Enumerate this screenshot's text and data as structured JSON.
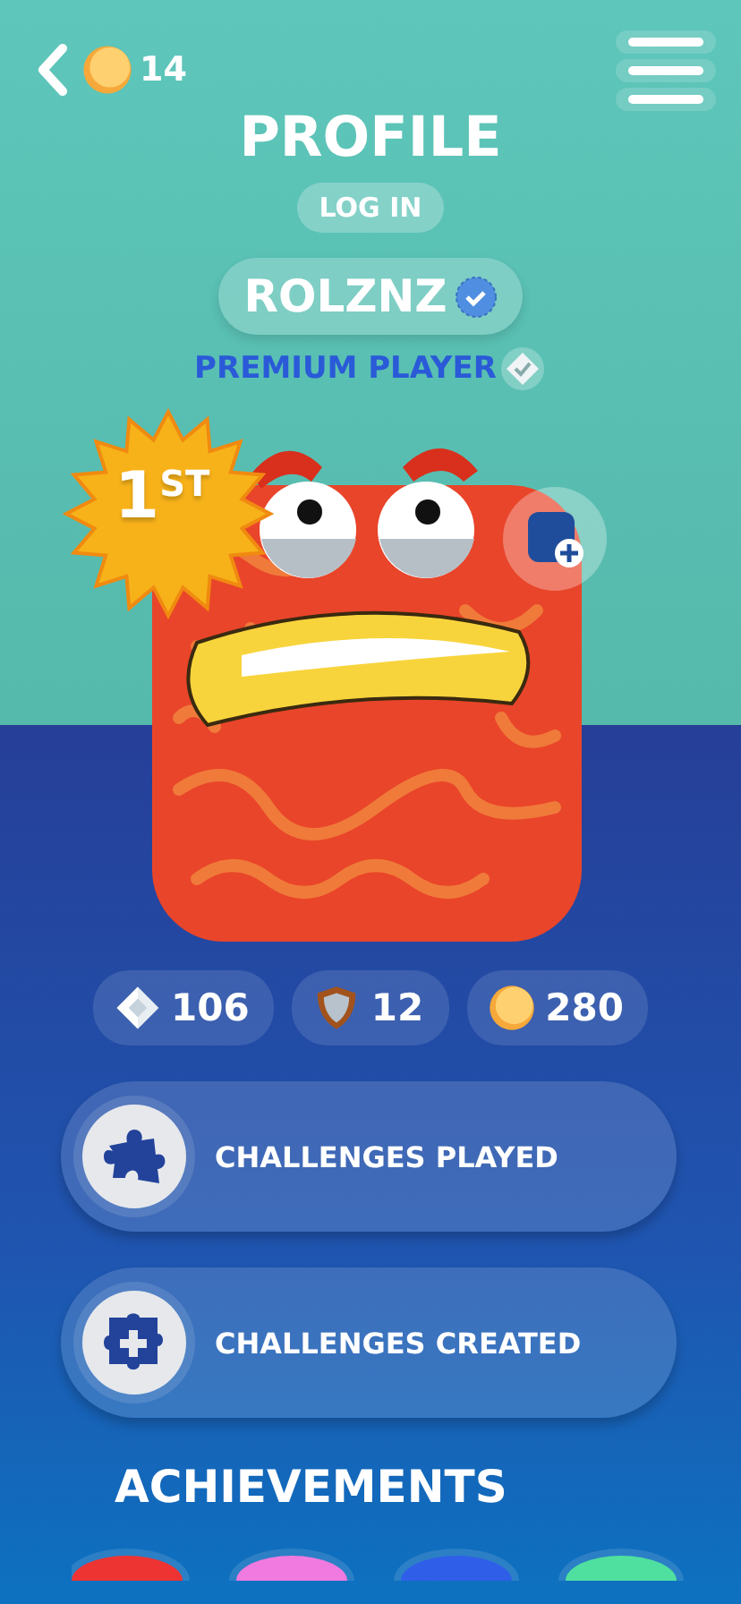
{
  "header": {
    "coins": "14"
  },
  "title": "PROFILE",
  "login_button": "LOG IN",
  "username": {
    "name": "ROLZNZ",
    "verified": true
  },
  "status": "PREMIUM PLAYER",
  "rank": "1$^{ST}$",
  "stats": [
    {
      "kind": "gem",
      "value": "106"
    },
    {
      "kind": "shield",
      "value": "12"
    },
    {
      "kind": "coin",
      "value": "280"
    }
  ],
  "menu": [
    {
      "kind": "played",
      "label": "CHALLENGES PLAYED"
    },
    {
      "kind": "created",
      "label": "CHALLENGES CREATED"
    }
  ],
  "achievements": {
    "title": "ACHIEVEMENTS",
    "items": [
      {
        "color": "#ee3333"
      },
      {
        "color": "#f07ae0"
      },
      {
        "color": "#2f5fe8"
      },
      {
        "color": "#4fe0a0"
      }
    ]
  }
}
